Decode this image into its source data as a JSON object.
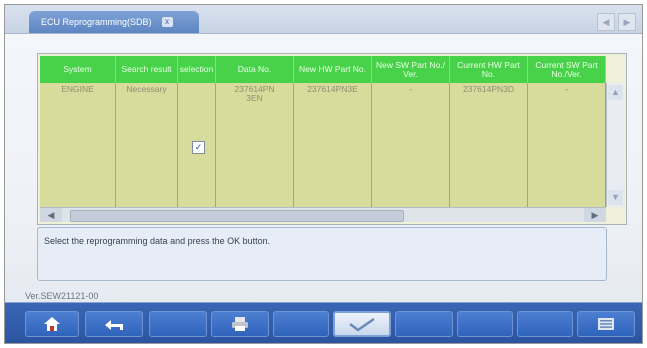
{
  "tab": {
    "title": "ECU Reprogramming(SDB)",
    "close_glyph": "x"
  },
  "nav": {
    "prev_glyph": "◀",
    "next_glyph": "▶"
  },
  "table": {
    "headers": [
      "System",
      "Search result",
      "selection",
      "Data No.",
      "New HW Part No.",
      "New SW Part No./ Ver.",
      "Current HW Part No.",
      "Current SW Part No./Ver."
    ],
    "row": {
      "system": "ENGINE",
      "search_result": "Necessary",
      "selected": true,
      "data_no": "237614PN 3EN",
      "new_hw": "237614PN3E",
      "new_sw": "-",
      "current_hw": "237614PN3D",
      "current_sw": "-"
    }
  },
  "scroll": {
    "up": "▲",
    "down": "▼",
    "left": "◀",
    "right": "▶"
  },
  "message": "Select the reprogramming data and press the OK button.",
  "version": "Ver.SEW21121-00",
  "toolbar": {
    "home_icon": "home-icon",
    "back_icon": "back-arrow-icon",
    "print_icon": "printer-icon",
    "ok_icon": "check-icon",
    "list_icon": "list-icon"
  }
}
